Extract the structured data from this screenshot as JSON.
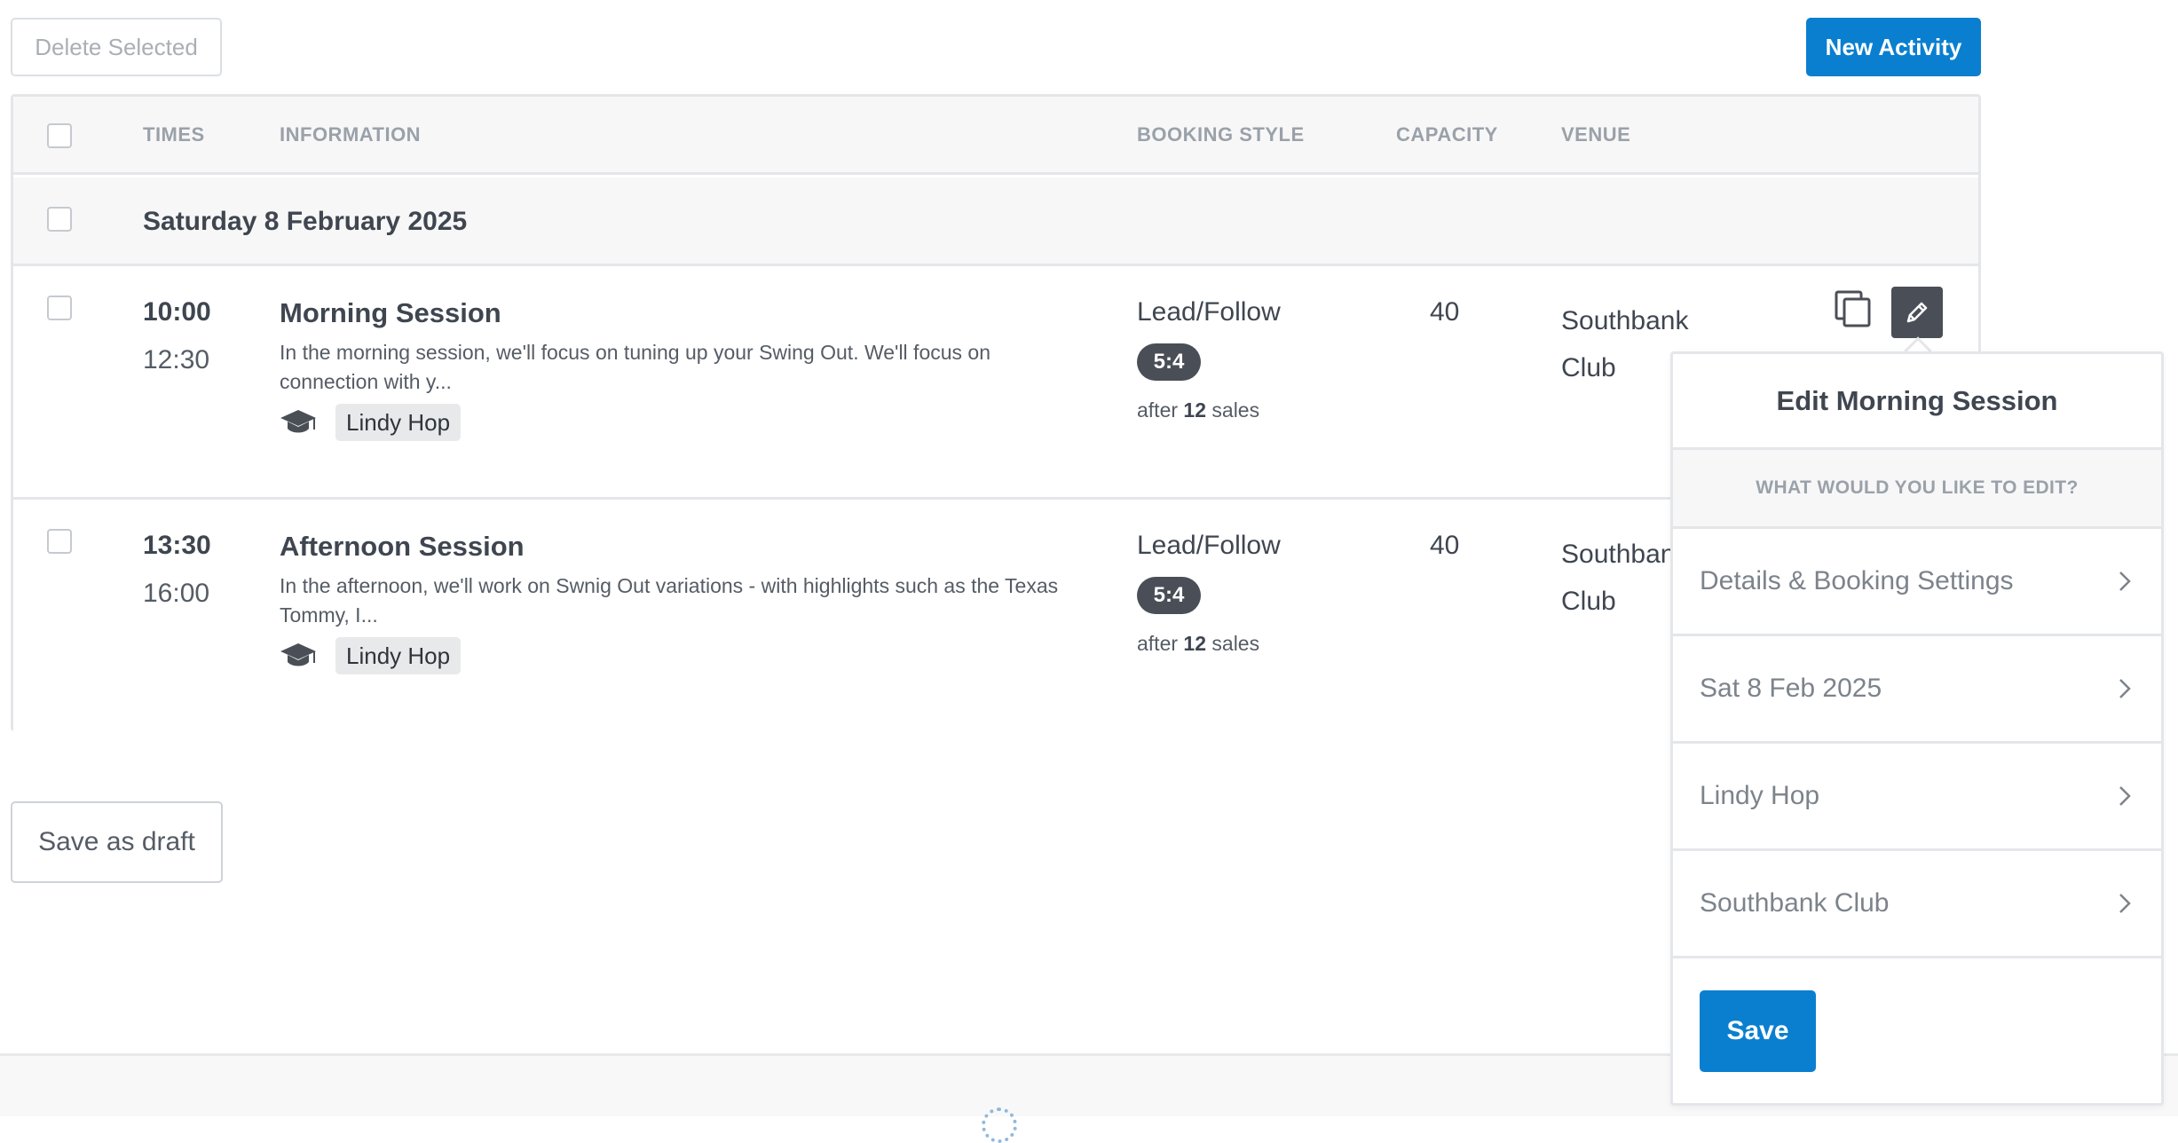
{
  "toolbar": {
    "delete_label": "Delete Selected",
    "new_label": "New Activity"
  },
  "table": {
    "headers": [
      "TIMES",
      "INFORMATION",
      "BOOKING STYLE",
      "CAPACITY",
      "VENUE"
    ],
    "group_date": "Saturday 8 February 2025",
    "rows": [
      {
        "start": "10:00",
        "end": "12:30",
        "title": "Morning Session",
        "description": "In the morning session, we'll focus on tuning up your Swing Out. We'll focus on connection with y...",
        "tag": "Lindy Hop",
        "booking_style": "Lead/Follow",
        "ratio": "5:4",
        "after_prefix": "after",
        "after_count": "12",
        "after_suffix": "sales",
        "capacity": "40",
        "venue": "Southbank Club"
      },
      {
        "start": "13:30",
        "end": "16:00",
        "title": "Afternoon Session",
        "description": "In the afternoon, we'll work on Swnig Out variations - with highlights such as the Texas Tommy, I...",
        "tag": "Lindy Hop",
        "booking_style": "Lead/Follow",
        "ratio": "5:4",
        "after_prefix": "after",
        "after_count": "12",
        "after_suffix": "sales",
        "capacity": "40",
        "venue": "Southbank Club"
      }
    ]
  },
  "draft_label": "Save as draft",
  "popover": {
    "title": "Edit Morning Session",
    "subtitle": "WHAT WOULD YOU LIKE TO EDIT?",
    "items": [
      "Details & Booking Settings",
      "Sat 8 Feb 2025",
      "Lindy Hop",
      "Southbank Club"
    ],
    "save_label": "Save"
  },
  "colors": {
    "primary": "#0a7fd0",
    "dark_badge": "#4a4f57",
    "border": "#e4e6e9"
  }
}
